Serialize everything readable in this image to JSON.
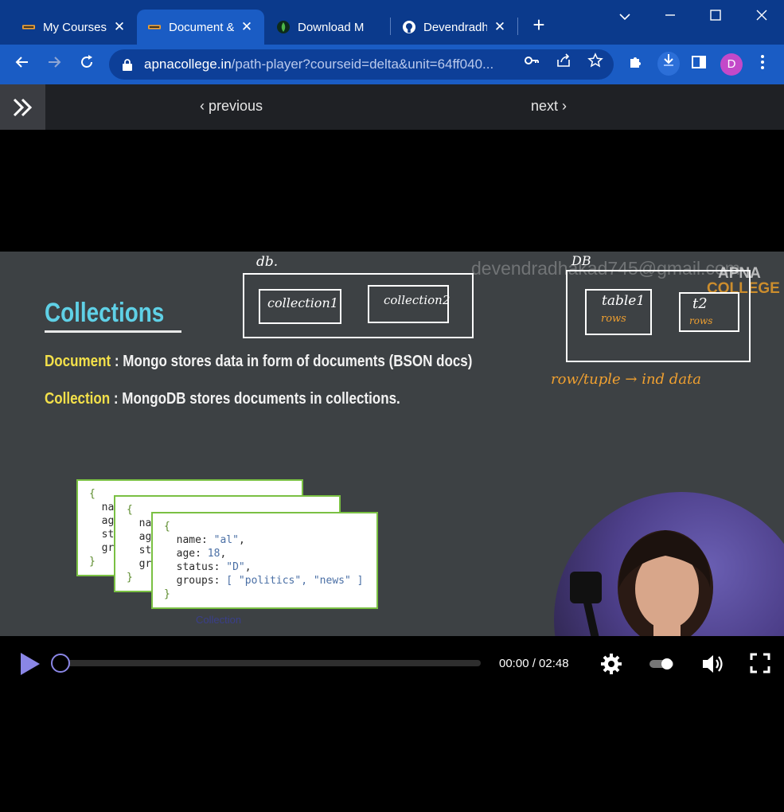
{
  "browser": {
    "tabs": [
      {
        "title": "My Courses",
        "favicon": "college-logo-icon",
        "active": false
      },
      {
        "title": "Document &",
        "favicon": "college-logo-icon",
        "active": true
      },
      {
        "title": "Download M",
        "favicon": "mongodb-leaf-icon",
        "active": false
      },
      {
        "title": "Devendradh",
        "favicon": "github-icon",
        "active": false
      }
    ],
    "new_tab": "+",
    "url_domain": "apnacollege.in",
    "url_path": "/path-player?courseid=delta&unit=64ff040...",
    "profile_initial": "D",
    "colors": {
      "tabstrip": "#0b3a8c",
      "toolbar": "#1a5cc4",
      "avatar": "#c349c9"
    }
  },
  "course_nav": {
    "previous_label": "previous",
    "next_label": "next"
  },
  "slide": {
    "heading": "Collections",
    "document_keyword": "Document",
    "document_text": " : Mongo stores data in form of documents (BSON docs)",
    "collection_keyword": "Collection",
    "collection_text": " : MongoDB stores documents in collections.",
    "watermark": "devendradhakad745@gmail.com",
    "brand_line1": "APNA",
    "brand_line2": "COLLEGE",
    "annotations": {
      "db_label": "db.",
      "collection1": "collection1",
      "collection2": "collection2",
      "DB_label": "DB",
      "table1": "table1",
      "table1_sub": "rows",
      "t2": "t2",
      "t2_sub": "rows",
      "row_note": "row/tuple → ind data"
    },
    "doc_card": {
      "name_key": "name",
      "name_val": "\"al\"",
      "age_key": "age",
      "age_val": "18",
      "status_key": "status",
      "status_val": "\"D\"",
      "groups_key": "groups",
      "groups_val": "[ \"politics\", \"news\" ]"
    },
    "back_card_keys": [
      "na",
      "ag",
      "st",
      "gr"
    ],
    "caption": "Collection"
  },
  "player": {
    "current_time": "00:00",
    "duration": "02:48",
    "time_display": "00:00 / 02:48",
    "progress": 0
  }
}
